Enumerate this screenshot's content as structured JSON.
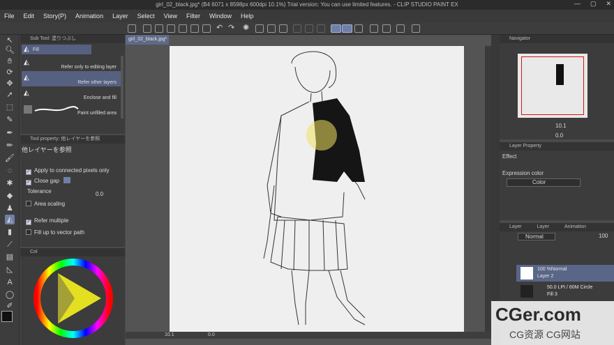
{
  "window": {
    "title": "girl_02_black.jpg* (B4 6071 x 8598px 600dpi 10.1%)  Trial version: You can use limited features. - CLIP STUDIO PAINT EX",
    "controls": [
      "—",
      "▢",
      "✕"
    ]
  },
  "menu": [
    "File",
    "Edit",
    "Story(P)",
    "Animation",
    "Layer",
    "Select",
    "View",
    "Filter",
    "Window",
    "Help"
  ],
  "subtool": {
    "panel_title": "Sub Tool: 塗りつぶし",
    "items": [
      {
        "label": "Fill",
        "selected": true
      },
      {
        "label": "Refer only to editing layer",
        "selected": false
      },
      {
        "label": "Refer other layers",
        "selected": true
      },
      {
        "label": "Enclose and fill",
        "selected": false
      },
      {
        "label": "Paint unfilled area",
        "selected": false
      }
    ]
  },
  "toolprop": {
    "panel_title": "Tool property: 他レイヤーを参照",
    "tool_name": "他レイヤーを参照",
    "apply_connected": "Apply to connected pixels only",
    "close_gap": "Close gap",
    "tolerance_label": "Tolerance",
    "tolerance_value": "0.0",
    "area_scaling": "Area scaling",
    "refer_multiple": "Refer multiple",
    "fill_vector": "Fill up to vector path"
  },
  "colorpanel": {
    "tab_label": "Col",
    "hue_hint": "58"
  },
  "canvas": {
    "doc_tab": "girl_02_black.jpg*",
    "zoom": "10.1",
    "status_value": "0.0"
  },
  "navigator": {
    "panel_title": "Navigator",
    "zoom": "10.1",
    "angle": "0.0"
  },
  "layer_property": {
    "panel_title": "Layer Property",
    "effect_label": "Effect",
    "expression_label": "Expression color",
    "expression_value": "Color"
  },
  "layers": {
    "tab_label": "Layer",
    "tab2_label": "Layer",
    "tab3_label": "Animation",
    "blend_mode": "Normal",
    "opacity": "100",
    "items": [
      {
        "blend": "100 %Normal",
        "name": "Layer 2",
        "selected": true
      },
      {
        "blend": "50.0 LPI / 60M Circle",
        "name": "Fill 3",
        "selected": false
      }
    ]
  },
  "watermark": {
    "brand": "CGer.com",
    "subtitle": "CG资源 CG网站"
  },
  "colors": {
    "accent": "#6f7fa8",
    "fill_yellow": "#f0e060",
    "brush_black": "#1a1a1a"
  }
}
